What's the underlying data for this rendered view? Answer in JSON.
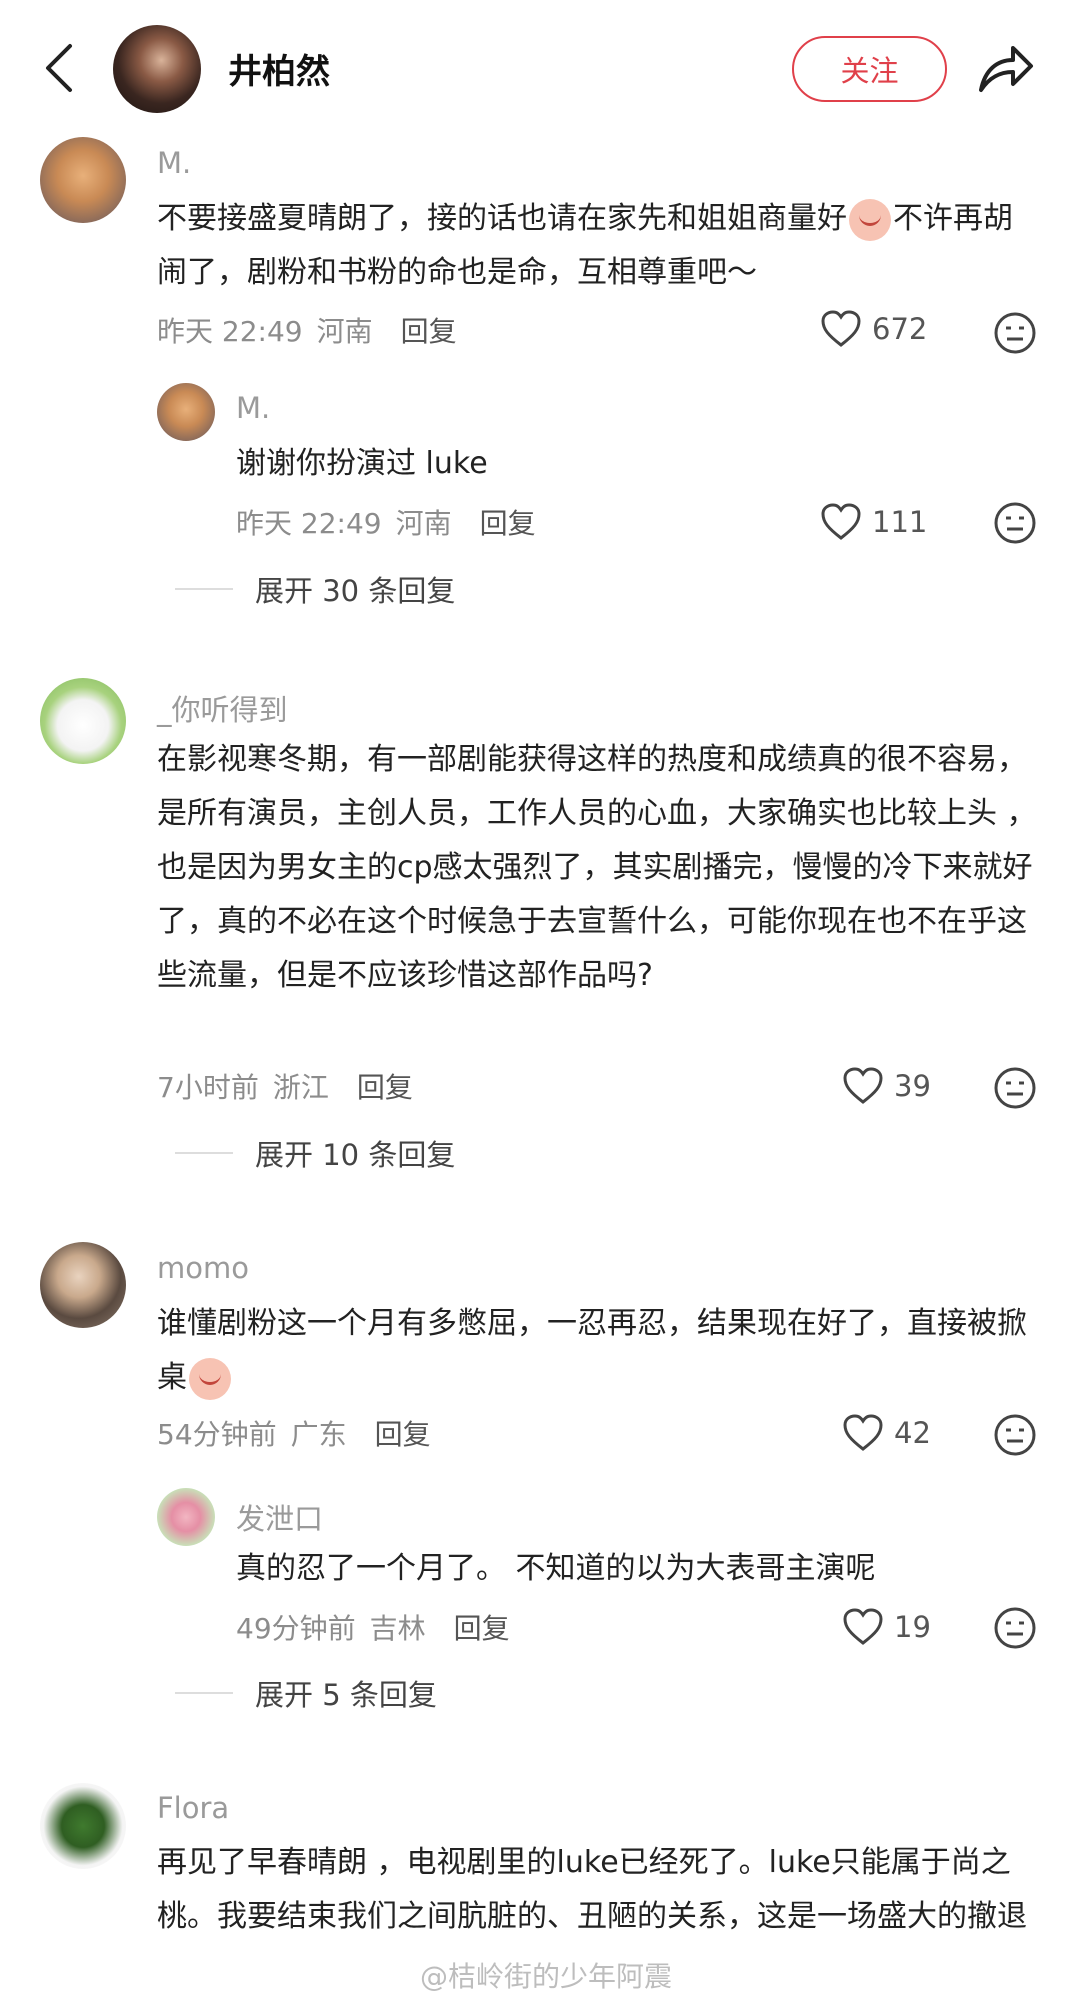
{
  "header": {
    "name": "井柏然",
    "follow_label": "关注"
  },
  "comments": [
    {
      "user": "M.",
      "text_a": "不要接盛夏晴朗了，接的话也请在家先和姐姐商量好",
      "text_b": "不许再胡闹了，剧粉和书粉的命也是命，互相尊重吧～",
      "time": "昨天 22:49",
      "location": "河南",
      "reply_label": "回复",
      "likes": "672"
    },
    {
      "user": "_你听得到",
      "text": "在影视寒冬期，有一部剧能获得这样的热度和成绩真的很不容易，是所有演员，主创人员，工作人员的心血，大家确实也比较上头 ， 也是因为男女主的cp感太强烈了，其实剧播完，慢慢的冷下来就好了，真的不必在这个时候急于去宣誓什么，可能你现在也不在乎这些流量，但是不应该珍惜这部作品吗?",
      "time": "7小时前",
      "location": "浙江",
      "reply_label": "回复",
      "likes": "39",
      "expand_label": "展开 10 条回复"
    },
    {
      "user": "momo",
      "text_a": "谁懂剧粉这一个月有多憋屈，一忍再忍，结果现在好了，直接被掀桌",
      "time": "54分钟前",
      "location": "广东",
      "reply_label": "回复",
      "likes": "42"
    },
    {
      "user": "Flora",
      "text": "再见了早春晴朗 ，电视剧里的luke已经死了。luke只能属于尚之桃。我要结束我们之间肮脏的、丑陋的关系，这是一场盛大的撤退"
    }
  ],
  "replies": [
    {
      "user": "M.",
      "text": "谢谢你扮演过 luke",
      "time": "昨天 22:49",
      "location": "河南",
      "reply_label": "回复",
      "likes": "111",
      "expand_label": "展开 30 条回复"
    },
    {
      "user": "发泄口",
      "text": "真的忍了一个月了。 不知道的以为大表哥主演呢",
      "time": "49分钟前",
      "location": "吉林",
      "reply_label": "回复",
      "likes": "19",
      "expand_label": "展开 5 条回复"
    }
  ],
  "watermark": "@桔岭街的少年阿震",
  "colors": {
    "accent": "#e0404a",
    "meta": "#8c8c8c",
    "username": "#9a9a9a"
  }
}
